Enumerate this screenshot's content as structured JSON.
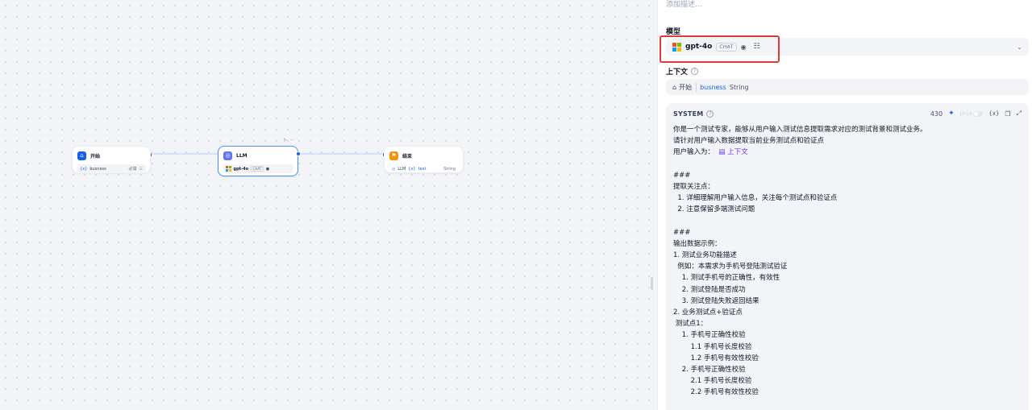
{
  "canvas": {
    "nodes": {
      "start": {
        "title": "开始",
        "var": "busness",
        "required": "必填",
        "icon": "home-icon"
      },
      "llm": {
        "title": "LLM",
        "model": "gpt-4o",
        "tag": "CHAT",
        "icon": "llm-icon"
      },
      "end": {
        "title": "结束",
        "source": "LLM",
        "var": "text",
        "type": "String",
        "icon": "flag-icon"
      }
    }
  },
  "panel": {
    "description_placeholder": "添加描述...",
    "model_label": "模型",
    "model": {
      "name": "gpt-4o",
      "tag": "CHAT"
    },
    "context_label": "上下文",
    "context": {
      "node": "开始",
      "var": "busness",
      "type": "String"
    },
    "system": {
      "title": "SYSTEM",
      "tokens": "430",
      "jinja": "Jinja",
      "var_button": "{x}",
      "lines": [
        "你是一个测试专家，能够从用户输入测试信息提取需求对应的测试背景和测试业务。",
        "请针对用户输入数据提取当前业务测试点和验证点",
        "用户输入为：",
        "",
        "###",
        "提取关注点：",
        "  1. 详细理解用户输入信息，关注每个测试点和验证点",
        "  2. 注意保留多端测试问题",
        "",
        "###",
        "输出数据示例：",
        "1. 测试业务功能描述",
        "  例如：本需求为手机号登陆测试验证",
        "    1. 测试手机号的正确性，有效性",
        "    2. 测试登陆是否成功",
        "    3. 测试登陆失败返回结果",
        "2. 业务测试点+验证点",
        " 测试点1：",
        "    1. 手机号正确性校验",
        "        1.1 手机号长度校验",
        "        1.2 手机号有效性校验",
        "    2. 手机号正确性校验",
        "        2.1 手机号长度校验",
        "        2.2 手机号有效性校验"
      ],
      "context_chip": "上下文"
    }
  },
  "colors": {
    "accent": "#155eef",
    "highlight": "#e53935",
    "ms_red": "#f25022",
    "ms_green": "#7fba00",
    "ms_blue": "#00a4ef",
    "ms_yellow": "#ffb900"
  }
}
